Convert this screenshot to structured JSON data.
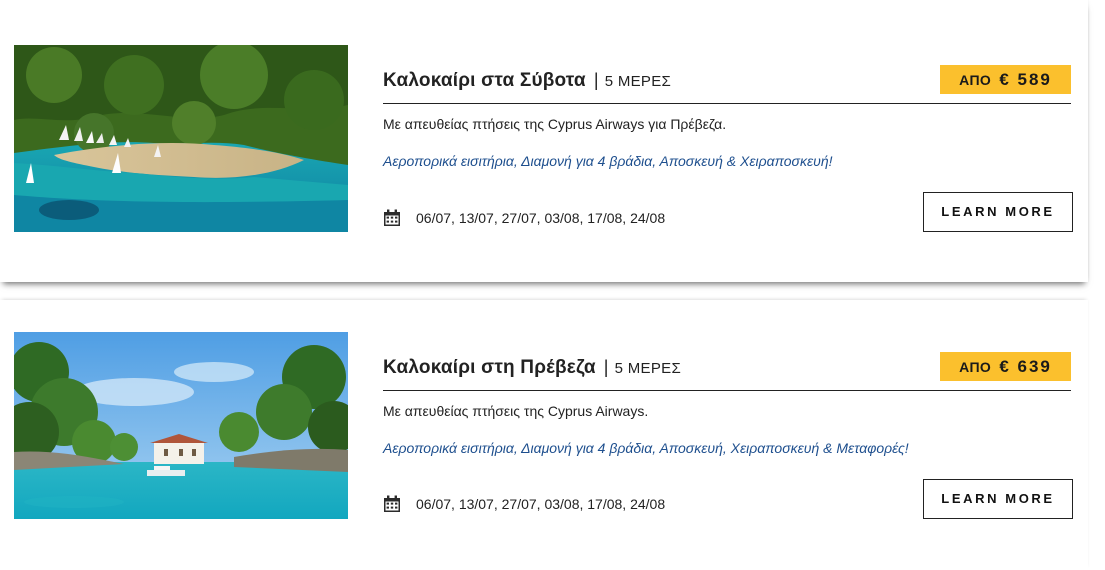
{
  "offers": [
    {
      "title": "Καλοκαίρι στα Σύβοτα",
      "separator": "|",
      "duration": "5 ΜΕΡΕΣ",
      "price_prefix": "ΑΠΟ",
      "price_amount": "€ 589",
      "description": "Με απευθείας πτήσεις της Cyprus Airways για Πρέβεζα.",
      "includes": "Αεροπορικά εισιτήρια, Διαμονή για 4 βράδια, Αποσκευή & Χειραποσκευή!",
      "dates": "06/07, 13/07, 27/07, 03/08, 17/08, 24/08",
      "button_label": "LEARN MORE",
      "image": "beach-with-sailboats-photo"
    },
    {
      "title": "Καλοκαίρι στη Πρέβεζα",
      "separator": "|",
      "duration": "5 ΜΕΡΕΣ",
      "price_prefix": "ΑΠΟ",
      "price_amount": "€ 639",
      "description": "Με απευθείας πτήσεις της Cyprus Airways.",
      "includes": "Αεροπορικά εισιτήρια, Διαμονή για 4 βράδια, Αποσκευή, Χειραποσκευή & Μεταφορές!",
      "dates": "06/07, 13/07, 27/07, 03/08, 17/08, 24/08",
      "button_label": "LEARN MORE",
      "image": "island-chapel-photo"
    }
  ],
  "colors": {
    "price_badge": "#fbc02d",
    "includes_text": "#1e4f8e",
    "text": "#222222"
  },
  "icons": {
    "dates": "calendar-icon"
  }
}
